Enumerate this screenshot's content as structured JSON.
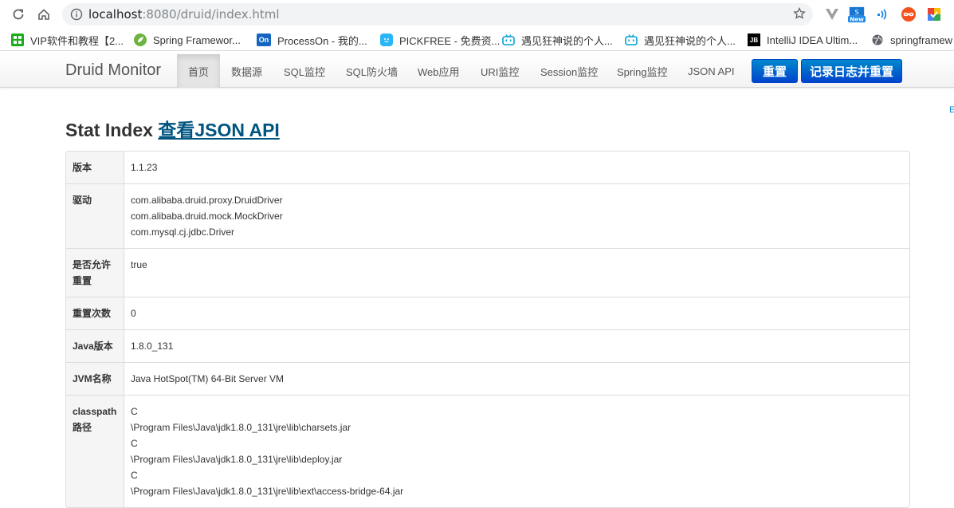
{
  "browser": {
    "url_host": "localhost",
    "url_rest": ":8080/druid/index.html"
  },
  "bookmarks": [
    {
      "label": "VIP软件和教程【2...",
      "icon": "green-grid-icon",
      "color": "#1aad19"
    },
    {
      "label": "Spring Framewor...",
      "icon": "spring-leaf-icon",
      "color": "#6db33f"
    },
    {
      "label": "ProcessOn - 我的...",
      "icon": "processon-icon",
      "color": "#1565c0"
    },
    {
      "label": "PICKFREE - 免费资...",
      "icon": "pickfree-icon",
      "color": "#29b6f6"
    },
    {
      "label": "遇见狂神说的个人...",
      "icon": "bilibili-icon",
      "color": "#00a1d6"
    },
    {
      "label": "遇见狂神说的个人...",
      "icon": "bilibili-icon",
      "color": "#00a1d6"
    },
    {
      "label": "IntelliJ IDEA Ultim...",
      "icon": "jetbrains-icon",
      "color": "#000000"
    },
    {
      "label": "springframew",
      "icon": "globe-icon",
      "color": "#5f6368"
    }
  ],
  "navbar": {
    "brand": "Druid Monitor",
    "items": [
      "首页",
      "数据源",
      "SQL监控",
      "SQL防火墙",
      "Web应用",
      "URI监控",
      "Session监控",
      "Spring监控",
      "JSON API"
    ],
    "reset_label": "重置",
    "log_reset_label": "记录日志并重置"
  },
  "page": {
    "title": "Stat Index",
    "json_link": "查看JSON API",
    "edge_text": "E"
  },
  "stats": [
    {
      "key": "版本",
      "values": [
        "1.1.23"
      ]
    },
    {
      "key": "驱动",
      "values": [
        "com.alibaba.druid.proxy.DruidDriver",
        "com.alibaba.druid.mock.MockDriver",
        "com.mysql.cj.jdbc.Driver"
      ]
    },
    {
      "key": "是否允许重置",
      "values": [
        "true"
      ]
    },
    {
      "key": "重置次数",
      "values": [
        "0"
      ]
    },
    {
      "key": "Java版本",
      "values": [
        "1.8.0_131"
      ]
    },
    {
      "key": "JVM名称",
      "values": [
        "Java HotSpot(TM) 64-Bit Server VM"
      ]
    },
    {
      "key": "classpath路径",
      "values": [
        "C",
        "\\Program Files\\Java\\jdk1.8.0_131\\jre\\lib\\charsets.jar",
        "C",
        "\\Program Files\\Java\\jdk1.8.0_131\\jre\\lib\\deploy.jar",
        "C",
        "\\Program Files\\Java\\jdk1.8.0_131\\jre\\lib\\ext\\access-bridge-64.jar"
      ]
    }
  ]
}
